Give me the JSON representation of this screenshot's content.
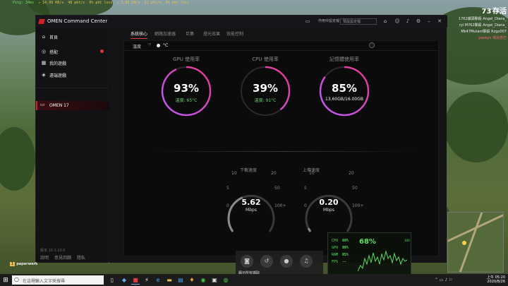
{
  "hud": {
    "stats": [
      "Ping: 34ms",
      "↗ 14.99 KB/s",
      "48 pkt/s",
      "0% pkt loss",
      "↘ 3.85 KB/s",
      "31 pkt/s",
      "0% pkt loss"
    ]
  },
  "killfeed": {
    "alive_count": "73",
    "alive_label": "存活",
    "lines": [
      "1762爆頭擊殺 Angel_Diana_",
      "ryi M762擊殺 Angel_Diana_",
      "Mk47Mutant擊殺 Rzgo007",
      "yaoayu 淘汰自己"
    ]
  },
  "app": {
    "title": "OMEN Command Center",
    "tray_text": "作用中設定檔",
    "profile_select": "預設設定檔",
    "colors": {
      "accent": "#d21f2a",
      "ok_green": "#5ed26a",
      "ring_start": "#c05bff",
      "ring_end": "#e03a8a"
    }
  },
  "sidebar": {
    "items": [
      {
        "label": "首頁",
        "icon": "home-icon"
      },
      {
        "label": "搭配",
        "icon": "compass-icon"
      },
      {
        "label": "我的遊戲",
        "icon": "gamepad-icon"
      },
      {
        "label": "遠端遊戲",
        "icon": "remote-icon"
      }
    ],
    "device": "OMEN 17",
    "version": "版本 10.3.10.0",
    "footer": [
      "說明",
      "意見回饋",
      "隱私"
    ]
  },
  "tabs": [
    "系統核心",
    "網路加速器",
    "巨集",
    "燈光效果",
    "效能控制"
  ],
  "temperature": {
    "label": "溫度",
    "f": "°F",
    "c": "°C"
  },
  "gauges": [
    {
      "title": "GPU 使用率",
      "percent": 93,
      "value": "93%",
      "sub": "溫度: 65°C"
    },
    {
      "title": "CPU 使用率",
      "percent": 39,
      "value": "39%",
      "sub": "溫度: 91°C"
    },
    {
      "title": "記憶體使用率",
      "percent": 85,
      "value": "85%",
      "sub": "13.60GB/16.00GB"
    }
  ],
  "network": [
    {
      "title": "下載速度",
      "value": "5.62",
      "unit": "Mbps",
      "scale": [
        "0",
        "5",
        "10",
        "20",
        "50",
        "100+"
      ]
    },
    {
      "title": "上傳速度",
      "value": "0.20",
      "unit": "Mbps",
      "scale": [
        "0",
        "5",
        "10",
        "20",
        "50",
        "100+"
      ]
    }
  ],
  "perf_overlay": {
    "rows": [
      {
        "k": "CPU",
        "v": "68%"
      },
      {
        "k": "GPU",
        "v": "96%"
      },
      {
        "k": "RAM",
        "v": "85%"
      },
      {
        "k": "FPS",
        "v": "--"
      }
    ],
    "big": "68%",
    "max": "100",
    "bottom": "60 () 0"
  },
  "gamebar": {
    "label": "顯示所有擷取"
  },
  "player": {
    "tag": "1",
    "name": "paperwerk"
  },
  "taskbar": {
    "search_placeholder": "在這裡輸入文字來搜尋",
    "time": "上午 05:20",
    "date": "2020/8/26"
  }
}
